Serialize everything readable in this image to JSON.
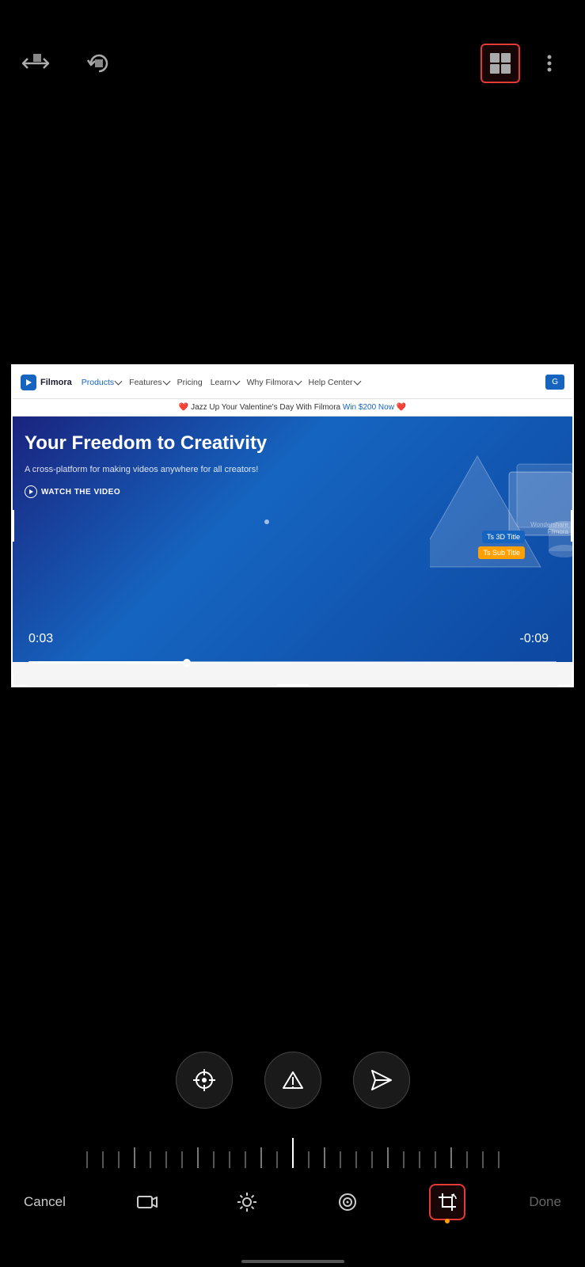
{
  "toolbar": {
    "transform_icon_label": "transform",
    "rotate_icon_label": "rotate",
    "layout_icon_label": "layout",
    "more_icon_label": "more"
  },
  "preview": {
    "nav": {
      "logo": "Filmora",
      "items": [
        "Products",
        "Features",
        "Pricing",
        "Learn",
        "Why Filmora",
        "Help Center"
      ],
      "cta": "G"
    },
    "banner": {
      "heart1": "❤️",
      "text": " Jazz Up Your Valentine's Day With Filmora ",
      "link": "Win $200 Now",
      "heart2": "❤️"
    },
    "hero": {
      "title": "Your Freedom to Creativity",
      "subtitle": "A cross-platform for making videos anywhere for all creators!",
      "cta": "WATCH THE VIDEO"
    },
    "time_current": "0:03",
    "time_remaining": "-0:09",
    "overlay_3d": "Ts 3D Title",
    "overlay_sub": "Ts Sub Title",
    "watermark": "Wondershare\nFilmora"
  },
  "controls": {
    "action_btns": [
      "lens",
      "pointer-up",
      "send-left"
    ],
    "tabs": [
      {
        "id": "video",
        "label": "video-camera",
        "active": false
      },
      {
        "id": "brightness",
        "label": "brightness",
        "active": false
      },
      {
        "id": "circle",
        "label": "circle",
        "active": false
      },
      {
        "id": "crop",
        "label": "crop-rotate",
        "active": true
      }
    ]
  },
  "footer": {
    "cancel_label": "Cancel",
    "done_label": "Done"
  }
}
